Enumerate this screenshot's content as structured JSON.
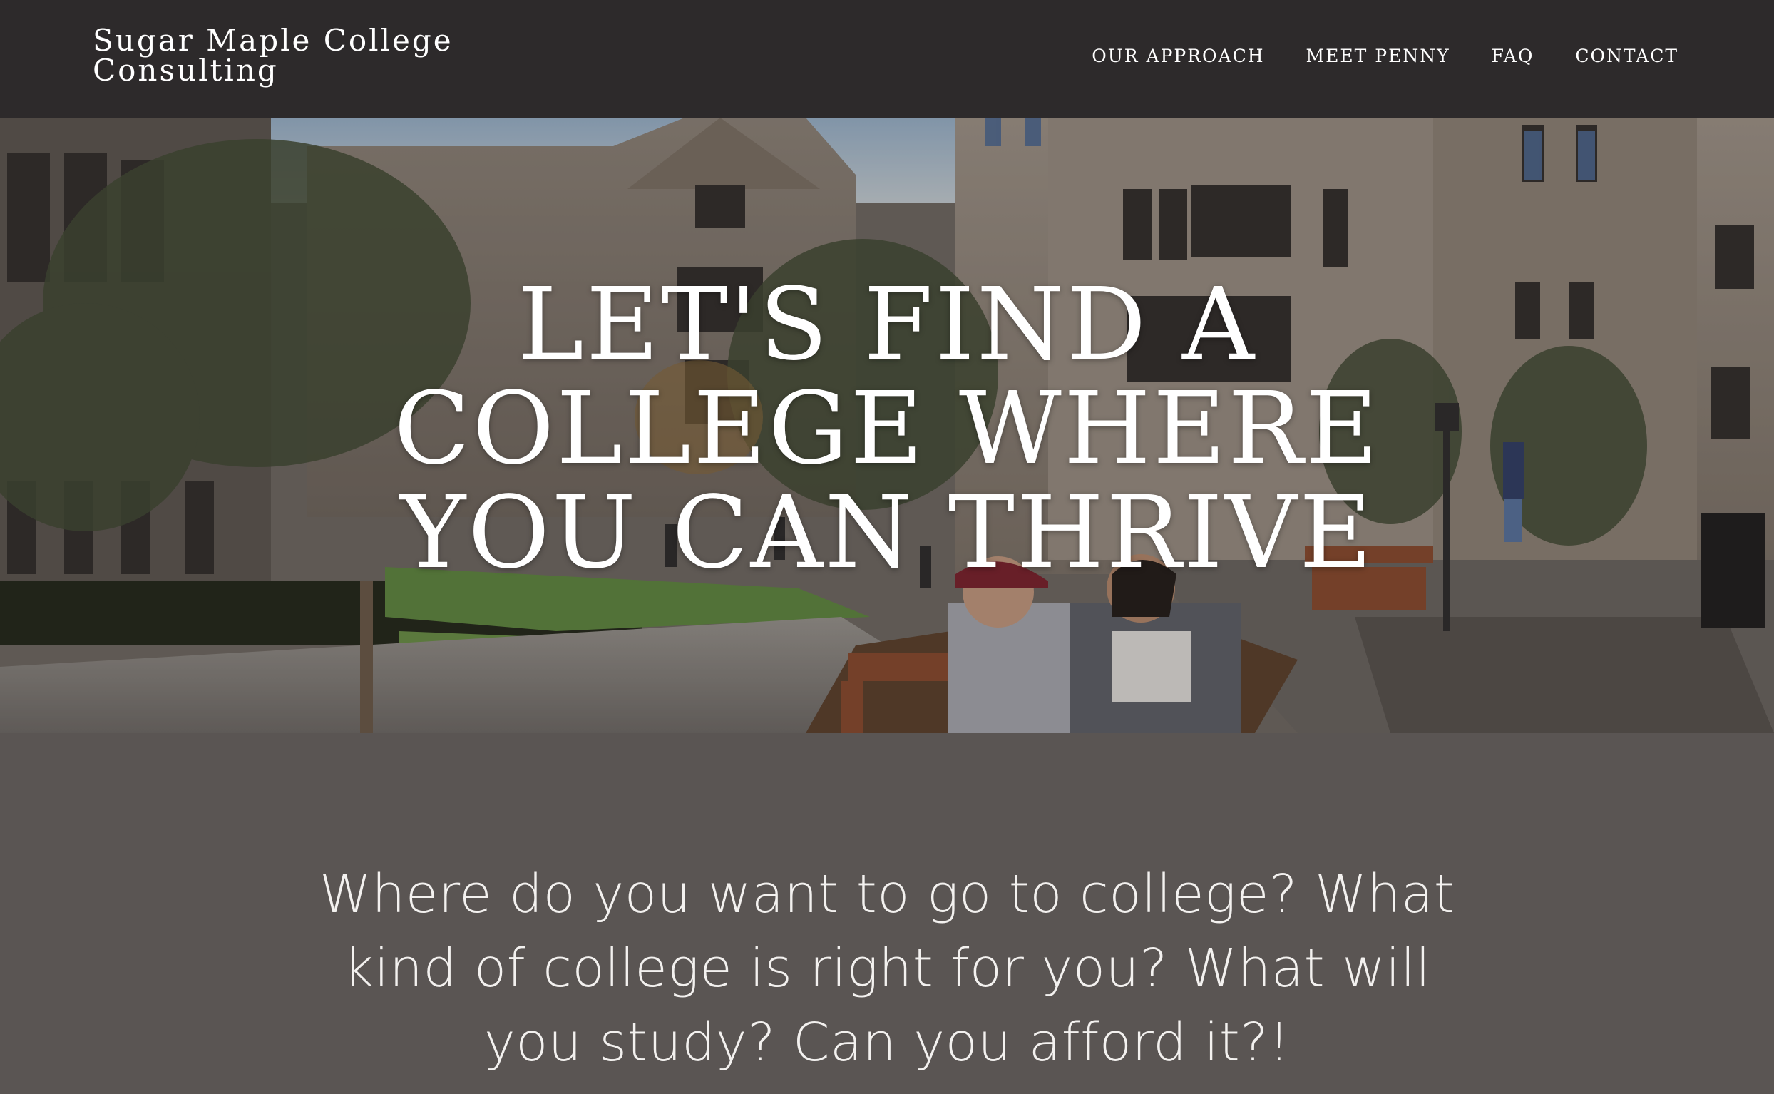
{
  "site": {
    "brand": "Sugar Maple College Consulting"
  },
  "nav": {
    "items": [
      "OUR APPROACH",
      "MEET PENNY",
      "FAQ",
      "CONTACT"
    ]
  },
  "hero": {
    "title_lines": [
      "LET'S FIND A",
      "COLLEGE WHERE",
      "YOU CAN THRIVE"
    ]
  },
  "intro": {
    "text": "Where do you want to go to college? What kind of college is right for you? What will you study? Can you afford it?!"
  },
  "colors": {
    "header_bg": "#2d2a2b",
    "intro_bg": "#5a5553",
    "text": "#ffffff"
  }
}
